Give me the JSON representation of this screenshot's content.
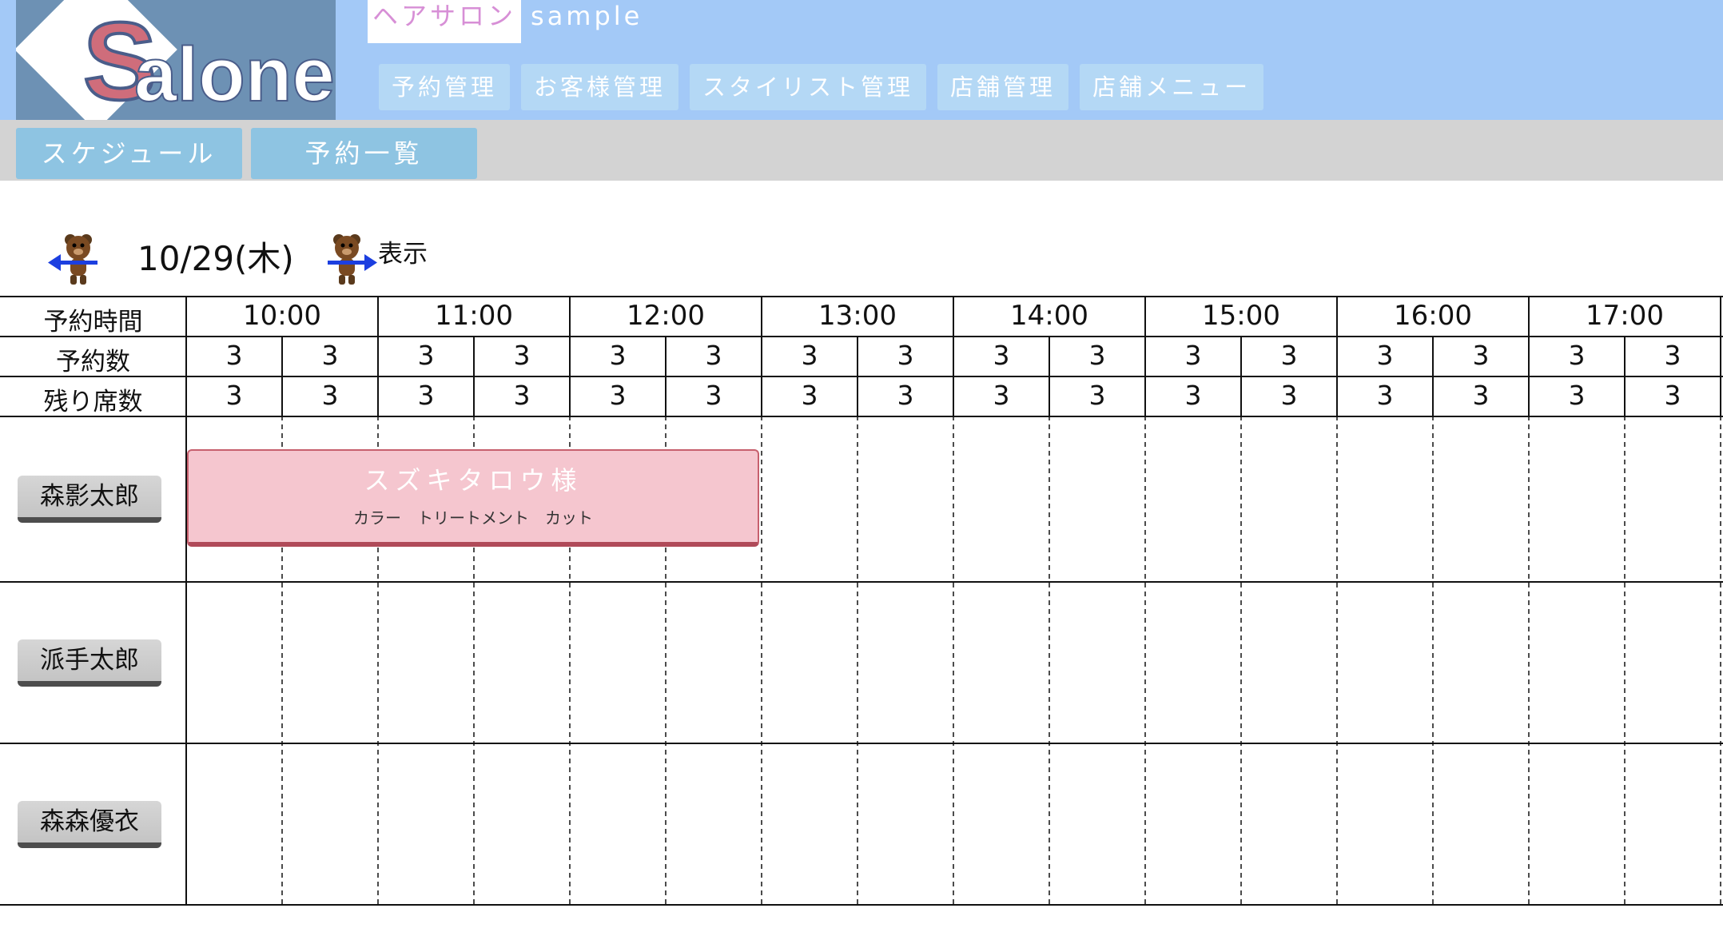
{
  "header": {
    "logo_text": "Salone",
    "shop_name": "ヘアサロン",
    "shop_suffix": "sample",
    "colors": {
      "bg": "#a3c9f7",
      "logo_bg": "#6d91b4",
      "nav_bg": "#b4d8f5",
      "shop_name": "#d78fd6"
    }
  },
  "nav": [
    {
      "label": "予約管理"
    },
    {
      "label": "お客様管理"
    },
    {
      "label": "スタイリスト管理"
    },
    {
      "label": "店舗管理"
    },
    {
      "label": "店舗メニュー"
    }
  ],
  "subnav": [
    {
      "label": "スケジュール"
    },
    {
      "label": "予約一覧"
    }
  ],
  "date_bar": {
    "prev_icon": "bear-arrow-left-icon",
    "date": "10/29(木)",
    "next_icon": "bear-arrow-right-icon",
    "show_label": "表示"
  },
  "schedule": {
    "row_labels": {
      "time": "予約時間",
      "reservations": "予約数",
      "remaining": "残り席数"
    },
    "times": [
      "10:00",
      "11:00",
      "12:00",
      "13:00",
      "14:00",
      "15:00",
      "16:00",
      "17:00"
    ],
    "reservations": [
      3,
      3,
      3,
      3,
      3,
      3,
      3,
      3,
      3,
      3,
      3,
      3,
      3,
      3,
      3,
      3
    ],
    "remaining": [
      3,
      3,
      3,
      3,
      3,
      3,
      3,
      3,
      3,
      3,
      3,
      3,
      3,
      3,
      3,
      3
    ],
    "stylists": [
      {
        "name": "森影太郎"
      },
      {
        "name": "派手太郎"
      },
      {
        "name": "森森優衣"
      }
    ],
    "bookings": [
      {
        "stylist": "森影太郎",
        "start": "10:00",
        "end": "13:00",
        "customer": "スズキタロウ様",
        "menu": "カラー　トリートメント　カット",
        "color": "#f5c6cf"
      }
    ]
  }
}
